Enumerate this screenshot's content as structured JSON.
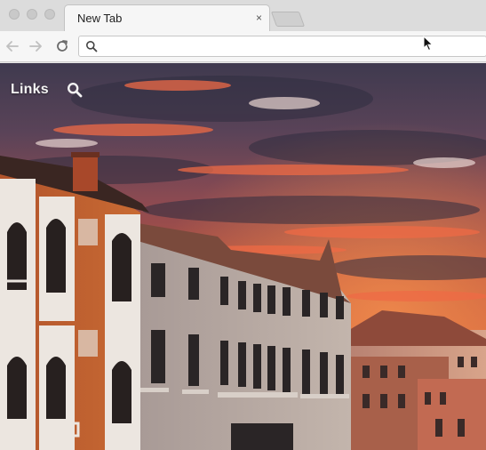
{
  "browser": {
    "tab": {
      "title": "New Tab",
      "close_glyph": "×"
    },
    "toolbar": {
      "back_icon": "back-arrow-icon",
      "forward_icon": "forward-arrow-icon",
      "reload_icon": "reload-icon",
      "omnibox_icon": "search-icon",
      "omnibox_value": ""
    }
  },
  "page": {
    "links_label": "Links",
    "search_icon": "search-icon",
    "background": "sunset-over-venetian-palazzos"
  },
  "colors": {
    "tabstrip": "#dcdcdc",
    "toolbar": "#f6f6f6",
    "sky_top": "#4a3d52",
    "sky_glow": "#d9553a",
    "building_orange": "#c65a2c"
  }
}
